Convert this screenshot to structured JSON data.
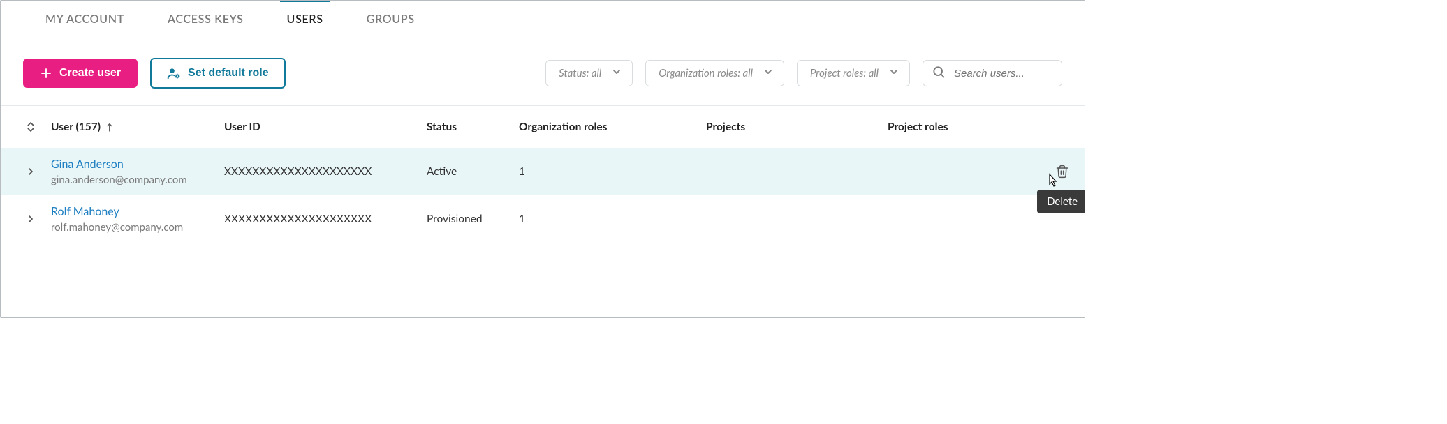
{
  "tabs": [
    {
      "label": "MY ACCOUNT",
      "active": false
    },
    {
      "label": "ACCESS KEYS",
      "active": false
    },
    {
      "label": "USERS",
      "active": true
    },
    {
      "label": "GROUPS",
      "active": false
    }
  ],
  "toolbar": {
    "create_user_label": "Create user",
    "set_default_role_label": "Set default role",
    "filters": {
      "status_label": "Status: all",
      "org_roles_label": "Organization roles: all",
      "project_roles_label": "Project roles: all"
    },
    "search_placeholder": "Search users..."
  },
  "columns": {
    "user_label": "User (157)",
    "user_id_label": "User ID",
    "status_label": "Status",
    "org_roles_label": "Organization roles",
    "projects_label": "Projects",
    "project_roles_label": "Project roles"
  },
  "rows": [
    {
      "name": "Gina Anderson",
      "email": "gina.anderson@company.com",
      "user_id": "XXXXXXXXXXXXXXXXXXXXX",
      "status": "Active",
      "org_roles": "1",
      "projects": "",
      "project_roles": "",
      "hover": true,
      "show_delete": true
    },
    {
      "name": "Rolf Mahoney",
      "email": "rolf.mahoney@company.com",
      "user_id": "XXXXXXXXXXXXXXXXXXXXX",
      "status": "Provisioned",
      "org_roles": "1",
      "projects": "",
      "project_roles": "",
      "hover": false,
      "show_delete": false
    }
  ],
  "tooltip_delete": "Delete"
}
